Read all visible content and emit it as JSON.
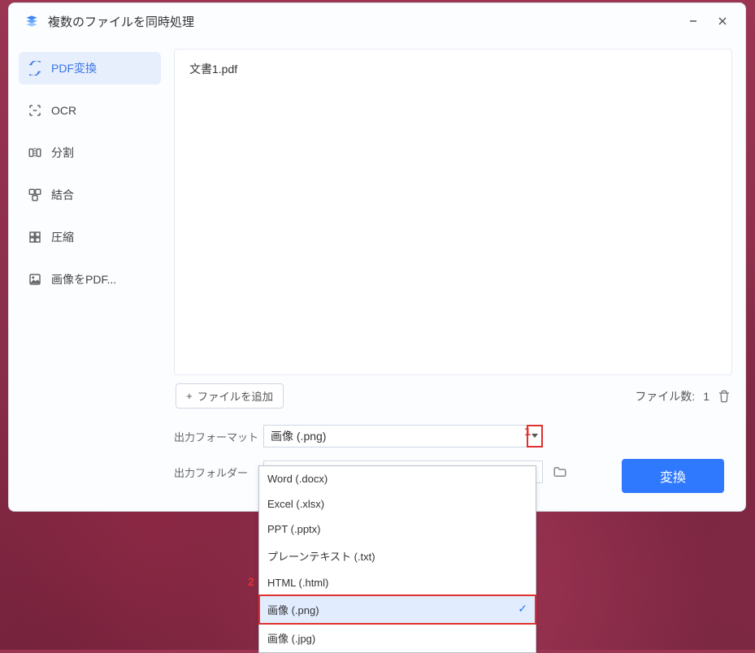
{
  "title": "複数のファイルを同時処理",
  "sidebar": {
    "items": [
      {
        "label": "PDF変換"
      },
      {
        "label": "OCR"
      },
      {
        "label": "分割"
      },
      {
        "label": "結合"
      },
      {
        "label": "圧縮"
      },
      {
        "label": "画像をPDF..."
      }
    ]
  },
  "file_list": {
    "files": [
      {
        "name": "文書1.pdf"
      }
    ],
    "add_button": "ファイルを追加",
    "count_label": "ファイル数:",
    "count_value": "1"
  },
  "settings": {
    "format_label": "出力フォーマット",
    "format_value": "画像 (.png)",
    "folder_label": "出力フォルダー"
  },
  "convert_button": "変換",
  "dropdown": {
    "options": [
      {
        "label": "Word (.docx)"
      },
      {
        "label": "Excel (.xlsx)"
      },
      {
        "label": "PPT (.pptx)"
      },
      {
        "label": "プレーンテキスト (.txt)"
      },
      {
        "label": "HTML (.html)"
      },
      {
        "label": "画像 (.png)",
        "selected": true
      },
      {
        "label": "画像 (.jpg)"
      }
    ]
  },
  "annotations": {
    "marker1": "1",
    "marker2": "2"
  }
}
